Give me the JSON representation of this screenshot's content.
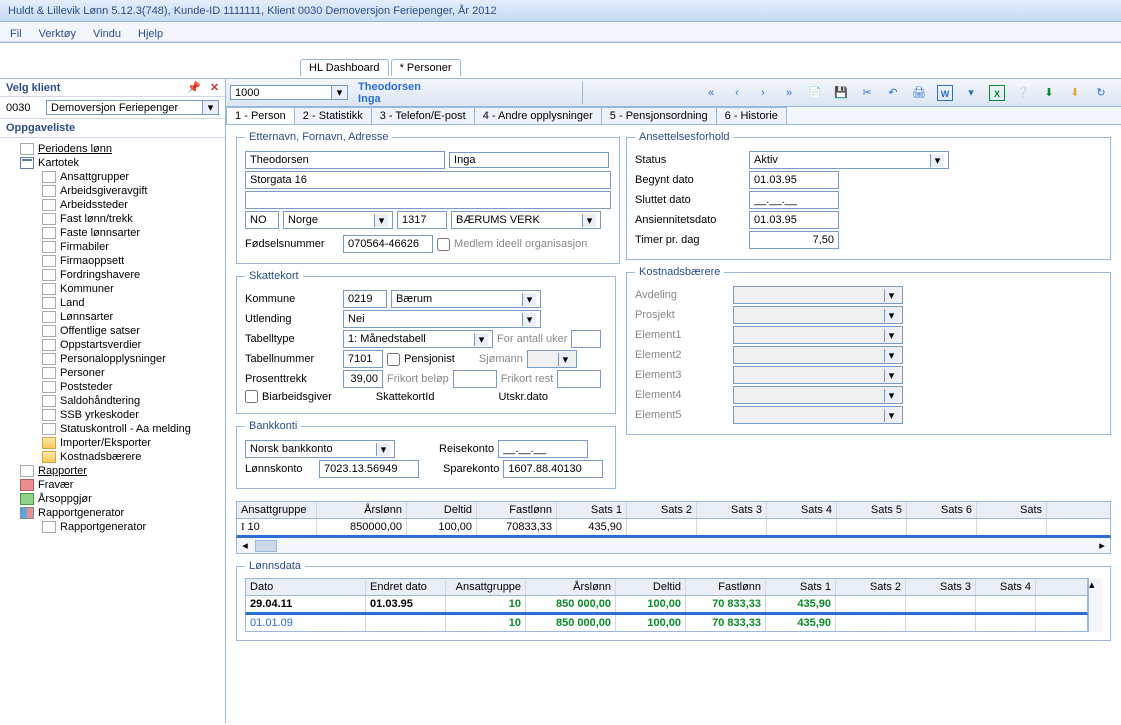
{
  "titlebar": "Huldt & Lillevik Lønn 5.12.3(748), Kunde-ID 1111111, Klient 0030 Demoversjon Feriepenger, År 2012",
  "menu": {
    "file": "Fil",
    "tools": "Verktøy",
    "window": "Vindu",
    "help": "Hjelp"
  },
  "maintabs": {
    "dashboard": "HL Dashboard",
    "personer": "* Personer"
  },
  "sidebar": {
    "velg_klient": "Velg klient",
    "klient_code": "0030",
    "klient_name": "Demoversjon Feriepenger",
    "oppgaveliste": "Oppgaveliste",
    "periodens_lonn": "Periodens lønn",
    "kartotek": "Kartotek",
    "items": [
      "Ansattgrupper",
      "Arbeidsgiveravgift",
      "Arbeidssteder",
      "Fast lønn/trekk",
      "Faste lønnsarter",
      "Firmabiler",
      "Firmaoppsett",
      "Fordringshavere",
      "Kommuner",
      "Land",
      "Lønnsarter",
      "Offentlige satser",
      "Oppstartsverdier",
      "Personalopplysninger",
      "Personer",
      "Poststeder",
      "Saldohåndtering",
      "SSB yrkeskoder",
      "Statuskontroll - Aa melding",
      "Importer/Eksporter",
      "Kostnadsbærere"
    ],
    "rapporter": "Rapporter",
    "fravaer": "Fravær",
    "arsoppgjor": "Årsoppgjør",
    "rapportgenerator": "Rapportgenerator",
    "rapportgenerator_item": "Rapportgenerator"
  },
  "topbar": {
    "id": "1000",
    "name": "Theodorsen Inga"
  },
  "subtabs": [
    "1 - Person",
    "2 - Statistikk",
    "3 - Telefon/E-post",
    "4 - Andre opplysninger",
    "5 - Pensjonsordning",
    "6 - Historie"
  ],
  "person": {
    "legend": "Etternavn, Fornavn, Adresse",
    "etternavn": "Theodorsen",
    "fornavn": "Inga",
    "adresse": "Storgata 16",
    "land_code": "NO",
    "land": "Norge",
    "postnr": "1317",
    "poststed": "BÆRUMS VERK",
    "fodselsnr_label": "Fødselsnummer",
    "fodselsnr": "070564-46626",
    "medlem_ideell": "Medlem ideell organisasjon"
  },
  "skattekort": {
    "legend": "Skattekort",
    "kommune_label": "Kommune",
    "kommune_code": "0219",
    "kommune": "Bærum",
    "utlending_label": "Utlending",
    "utlending": "Nei",
    "tabelltype_label": "Tabelltype",
    "tabelltype": "1: Månedstabell",
    "for_antall_uker": "For antall uker",
    "tabellnummer_label": "Tabellnummer",
    "tabellnummer": "7101",
    "pensjonist": "Pensjonist",
    "sjomann": "Sjømann",
    "prosenttrekk_label": "Prosenttrekk",
    "prosenttrekk": "39,00",
    "frikort_belop": "Frikort beløp",
    "frikort_rest": "Frikort rest",
    "biarbeidsgiver": "Biarbeidsgiver",
    "skattekortid": "SkattekortId",
    "utskr": "Utskr.dato"
  },
  "bank": {
    "legend": "Bankkonti",
    "type": "Norsk bankkonto",
    "lonnskonto_label": "Lønnskonto",
    "lonnskonto": "7023.13.56949",
    "reisekonto_label": "Reisekonto",
    "reisekonto": "__.__.__",
    "sparekonto_label": "Sparekonto",
    "sparekonto": "1607.88.40130"
  },
  "ansettelse": {
    "legend": "Ansettelsesforhold",
    "status_label": "Status",
    "status": "Aktiv",
    "begynt_label": "Begynt dato",
    "begynt": "01.03.95",
    "sluttet_label": "Sluttet dato",
    "sluttet": "__.__.__",
    "ansiennitet_label": "Ansiennitetsdato",
    "ansiennitet": "01.03.95",
    "timer_label": "Timer pr. dag",
    "timer": "7,50"
  },
  "kost": {
    "legend": "Kostnadsbærere",
    "labels": [
      "Avdeling",
      "Prosjekt",
      "Element1",
      "Element2",
      "Element3",
      "Element4",
      "Element5"
    ]
  },
  "ansattgrid": {
    "headers": [
      "Ansattgruppe",
      "Årslønn",
      "Deltid",
      "Fastlønn",
      "Sats 1",
      "Sats 2",
      "Sats 3",
      "Sats 4",
      "Sats 5",
      "Sats 6",
      "Sats"
    ],
    "row": [
      "10",
      "850000,00",
      "100,00",
      "70833,33",
      "435,90"
    ]
  },
  "lonnsdata": {
    "legend": "Lønnsdata",
    "headers": [
      "Dato",
      "Endret dato",
      "Ansattgruppe",
      "Årslønn",
      "Deltid",
      "Fastlønn",
      "Sats 1",
      "Sats 2",
      "Sats 3",
      "Sats 4"
    ],
    "rows": [
      {
        "dato": "29.04.11",
        "endret": "01.03.95",
        "ag": "10",
        "arslonn": "850 000,00",
        "deltid": "100,00",
        "fastlonn": "70 833,33",
        "s1": "435,90",
        "bold": true
      },
      {
        "dato": "01.01.09",
        "endret": "",
        "ag": "10",
        "arslonn": "850 000,00",
        "deltid": "100,00",
        "fastlonn": "70 833,33",
        "s1": "435,90",
        "bold": false
      }
    ]
  }
}
